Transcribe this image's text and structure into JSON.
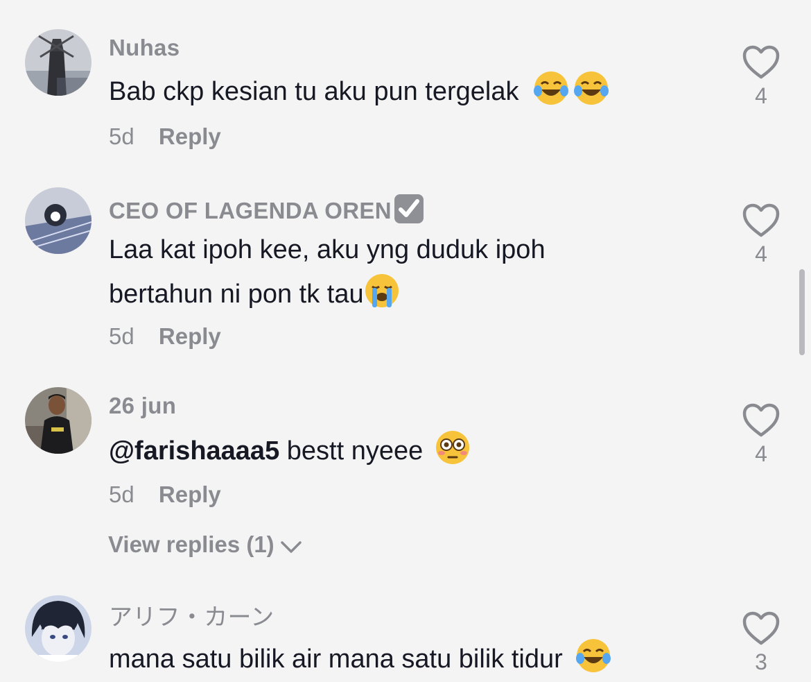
{
  "comments": [
    {
      "username": "Nuhas",
      "text": "Bab ckp kesian tu aku pun tergelak",
      "emojis": [
        "face-with-tears-of-joy",
        "face-with-tears-of-joy"
      ],
      "time": "5d",
      "reply_label": "Reply",
      "likes": "4"
    },
    {
      "username": "CEO OF LAGENDA OREN",
      "username_badge": "check-mark-button",
      "text": "Laa kat ipoh kee, aku yng duduk ipoh bertahun ni pon tk tau",
      "emojis": [
        "loudly-crying-face"
      ],
      "time": "5d",
      "reply_label": "Reply",
      "likes": "4"
    },
    {
      "username": "26 jun",
      "mention": "@farishaaaa5",
      "text": " bestt nyeee ",
      "emojis": [
        "flushed-face"
      ],
      "time": "5d",
      "reply_label": "Reply",
      "likes": "4",
      "view_replies": "View replies (1)"
    },
    {
      "username": "アリフ・カーン",
      "text": "mana satu bilik air mana satu bilik tidur",
      "emojis": [
        "face-with-tears-of-joy"
      ],
      "likes": "3"
    }
  ],
  "colors": {
    "background": "#f4f4f4",
    "primary_text": "#161823",
    "secondary_text": "#8a8b91"
  }
}
